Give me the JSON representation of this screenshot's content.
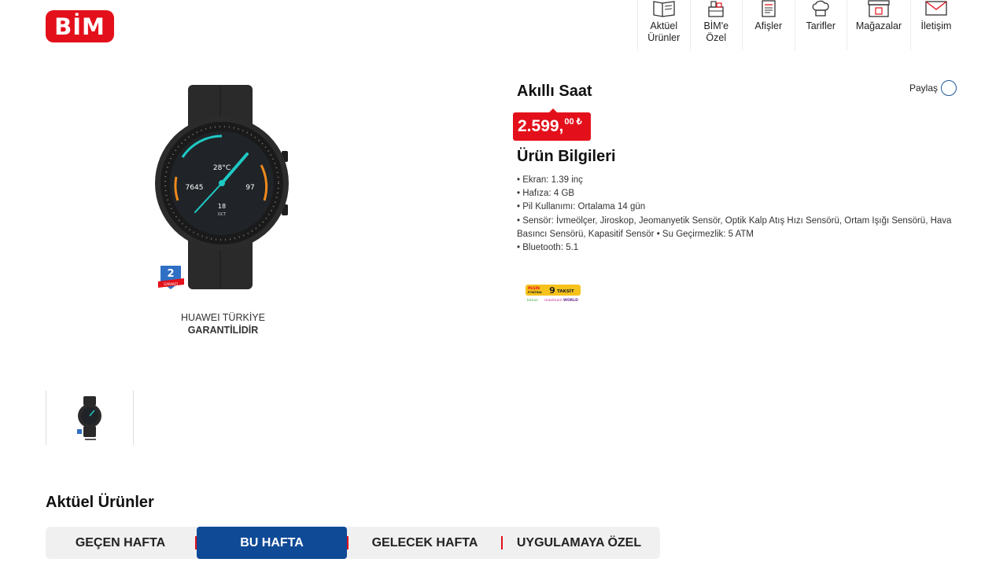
{
  "logo": {
    "text": "BİM"
  },
  "nav": {
    "items": [
      {
        "label": "Aktüel\nÜrünler",
        "icon": "catalog-icon"
      },
      {
        "label": "BİM'e\nÖzel",
        "icon": "products-icon"
      },
      {
        "label": "Afişler",
        "icon": "poster-icon"
      },
      {
        "label": "Tarifler",
        "icon": "chef-hat-icon"
      },
      {
        "label": "Mağazalar",
        "icon": "store-icon"
      },
      {
        "label": "İletişim",
        "icon": "envelope-icon"
      }
    ]
  },
  "product": {
    "title": "Akıllı Saat",
    "price": {
      "main": "2.599,",
      "decimals": "00",
      "currency": "₺"
    },
    "share_label": "Paylaş",
    "guarantee": {
      "line1": "HUAWEI TÜRKİYE",
      "line2": "GARANTİLİDİR"
    },
    "watch_face": {
      "temp": "28°C",
      "steps": "7645",
      "heart": "97",
      "date": "18",
      "month": "OCT"
    },
    "badge": {
      "number": "2",
      "text": "GARANTİ"
    },
    "info_title": "Ürün Bilgileri",
    "specs": [
      "• Ekran: 1.39 inç",
      "• Hafıza: 4 GB",
      "• Pil Kullanımı: Ortalama 14 gün",
      "• Sensör: İvmeölçer, Jiroskop, Jeomanyetik Sensör, Optik Kalp Atış Hızı Sensörü, Ortam Işığı Sensörü, Hava Basıncı Sensörü, Kapasitif Sensör • Su Geçirmezlik: 5 ATM",
      "• Bluetooth: 5.1"
    ],
    "installment": {
      "pesin": "PEŞİN",
      "fiyatina": "FİYATINA",
      "count": "9",
      "word": "TAKSİT",
      "cards": [
        "bonus",
        "maximum",
        "WORLD"
      ]
    }
  },
  "section": {
    "title": "Aktüel Ürünler",
    "tabs": [
      "GEÇEN HAFTA",
      "BU HAFTA",
      "GELECEK HAFTA",
      "UYGULAMAYA ÖZEL"
    ],
    "active_tab": "BU HAFTA"
  },
  "colors": {
    "brand_red": "#e3101b",
    "brand_blue": "#0f4a96"
  }
}
